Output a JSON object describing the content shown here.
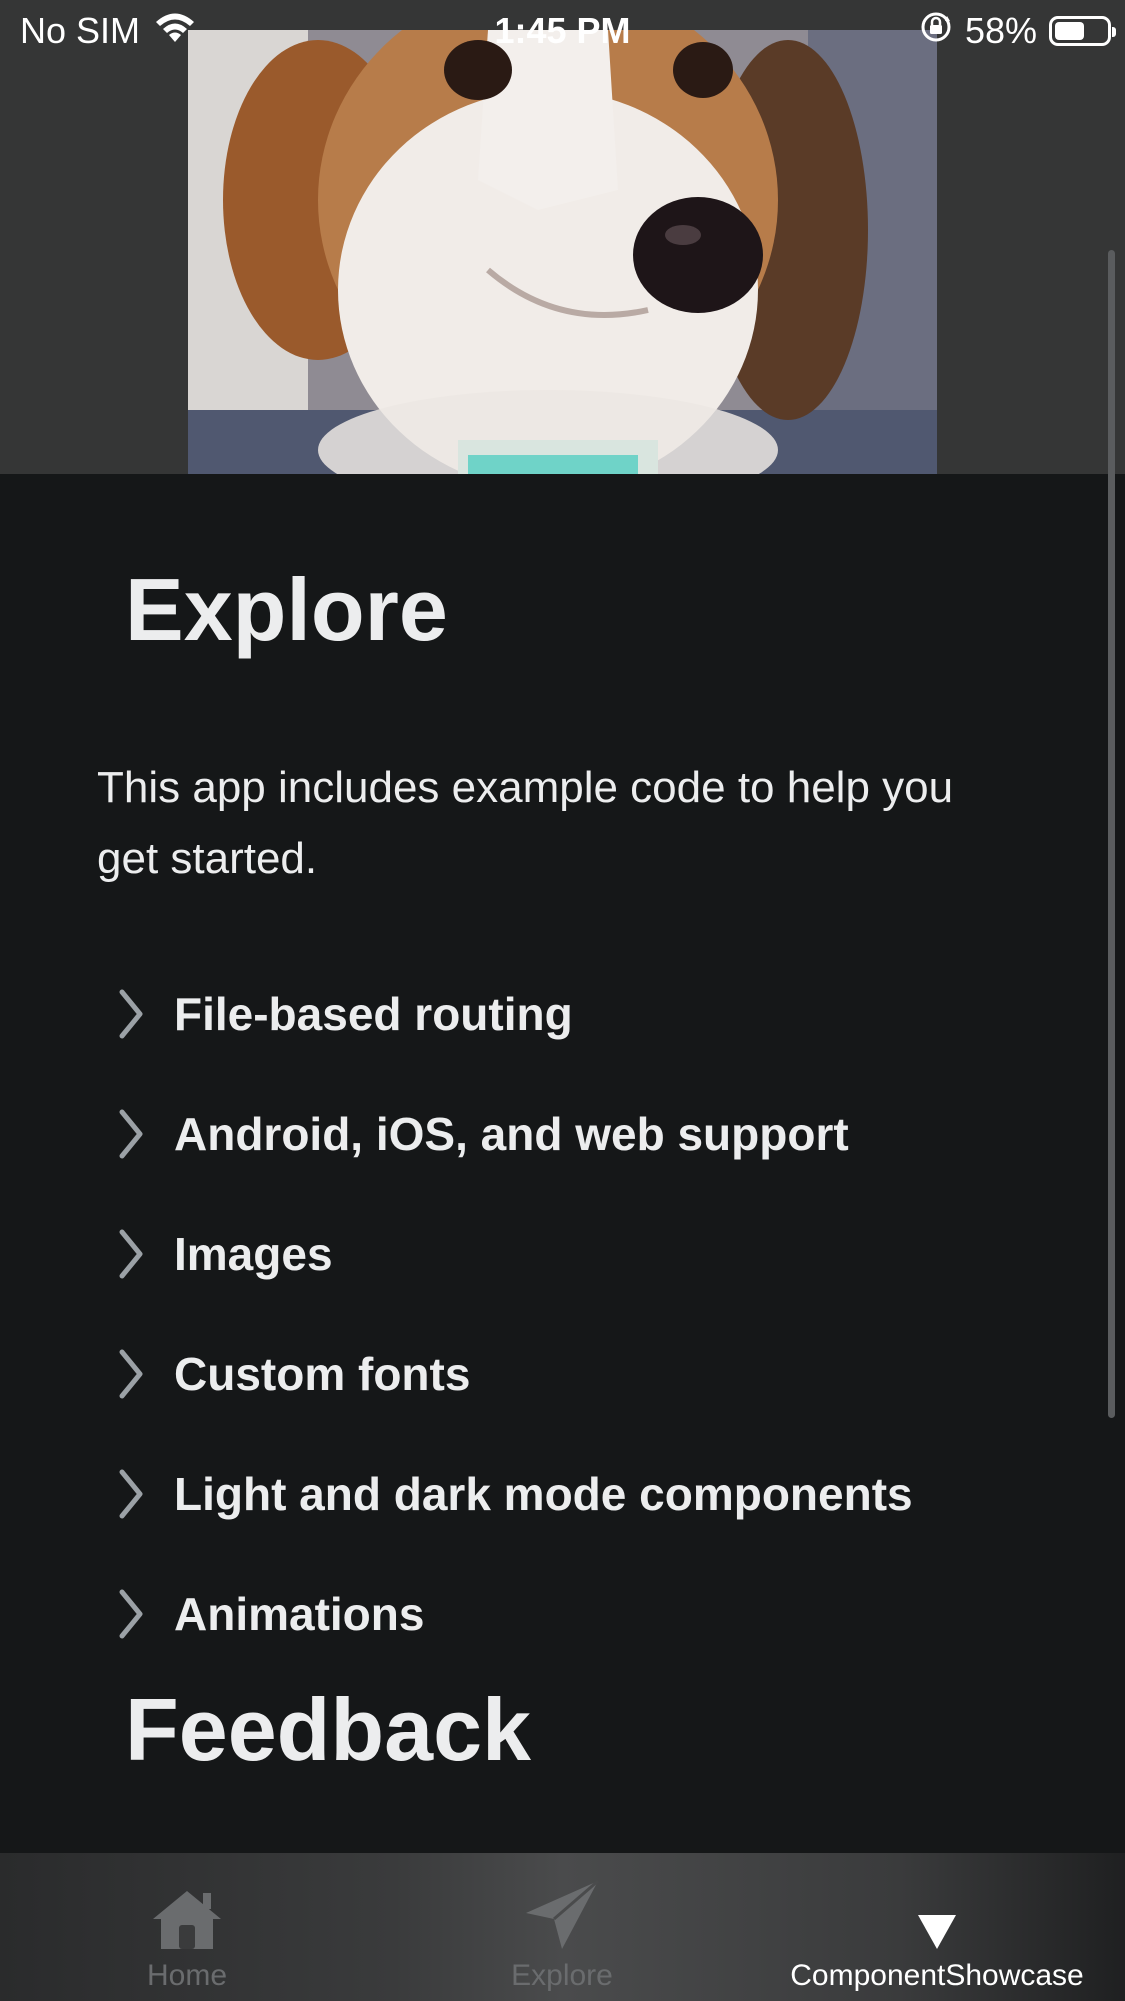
{
  "status_bar": {
    "carrier": "No SIM",
    "time": "1:45 PM",
    "battery": "58%",
    "battery_level": 0.58
  },
  "header": {
    "image": "dog-photo"
  },
  "main": {
    "title": "Explore",
    "intro": "This app includes example code to help you get started.",
    "collapsibles": [
      {
        "label": "File-based routing"
      },
      {
        "label": "Android, iOS, and web support"
      },
      {
        "label": "Images"
      },
      {
        "label": "Custom fonts"
      },
      {
        "label": "Light and dark mode components"
      },
      {
        "label": "Animations"
      }
    ],
    "feedback_title": "Feedback"
  },
  "tabs": [
    {
      "label": "Home",
      "icon": "house-icon",
      "active": false
    },
    {
      "label": "Explore",
      "icon": "paper-plane-icon",
      "active": false
    },
    {
      "label": "ComponentShowcase",
      "icon": "triangle-down-icon",
      "active": true
    }
  ],
  "colors": {
    "background": "#151718",
    "header_background": "#353636",
    "text": "#ECEDEE",
    "tab_inactive": "#6a6c6e",
    "tab_active": "#ffffff"
  }
}
